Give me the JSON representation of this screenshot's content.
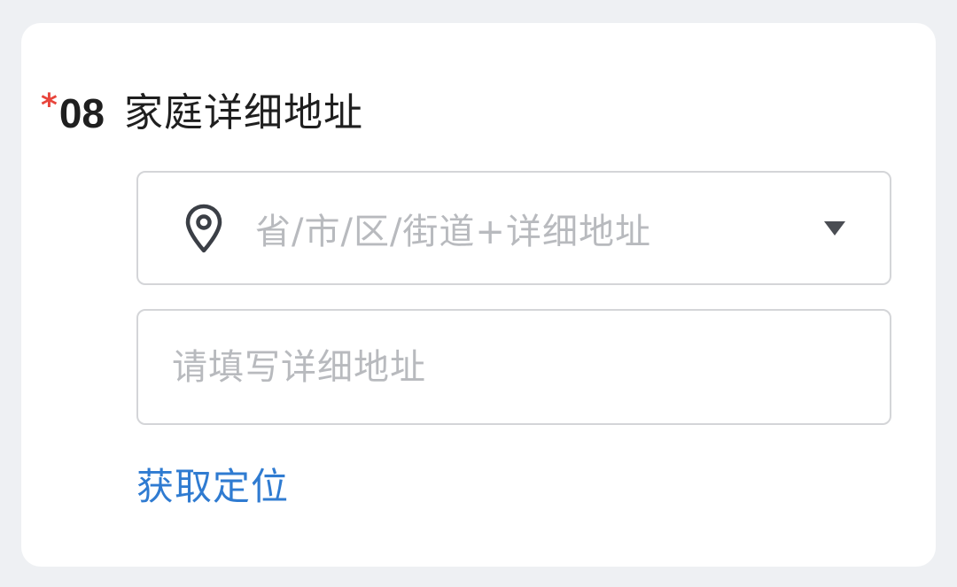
{
  "question": {
    "required_mark": "*",
    "number": "08",
    "title": "家庭详细地址"
  },
  "address_select": {
    "placeholder": "省/市/区/街道+详细地址",
    "icon": "location-pin-icon",
    "dropdown_icon": "triangle-down-icon"
  },
  "detail_input": {
    "value": "",
    "placeholder": "请填写详细地址"
  },
  "get_location": {
    "label": "获取定位"
  },
  "colors": {
    "required": "#e8453c",
    "link": "#2f7bd1",
    "placeholder": "#b8babe",
    "border": "#d4d5d8",
    "background": "#eef0f3"
  }
}
